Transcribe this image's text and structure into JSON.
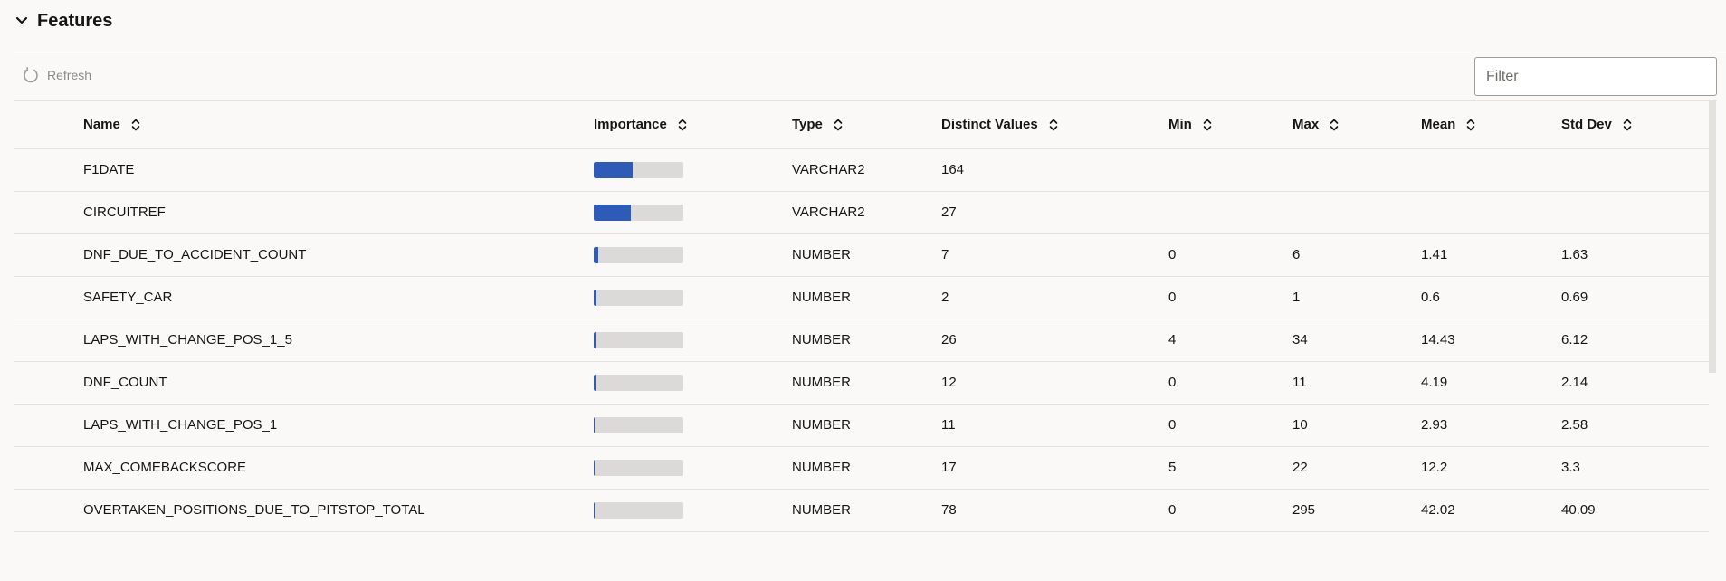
{
  "section": {
    "title": "Features",
    "expanded": true
  },
  "toolbar": {
    "refresh_label": "Refresh",
    "filter_placeholder": "Filter",
    "filter_value": ""
  },
  "colors": {
    "importance_fill": "#2e5bb8",
    "importance_track": "#dcdad8"
  },
  "table": {
    "columns": [
      "Name",
      "Importance",
      "Type",
      "Distinct Values",
      "Min",
      "Max",
      "Mean",
      "Std Dev"
    ],
    "rows": [
      {
        "name": "F1DATE",
        "importance": 0.43,
        "type": "VARCHAR2",
        "distinct": "164",
        "min": "",
        "max": "",
        "mean": "",
        "std": ""
      },
      {
        "name": "CIRCUITREF",
        "importance": 0.41,
        "type": "VARCHAR2",
        "distinct": "27",
        "min": "",
        "max": "",
        "mean": "",
        "std": ""
      },
      {
        "name": "DNF_DUE_TO_ACCIDENT_COUNT",
        "importance": 0.05,
        "type": "NUMBER",
        "distinct": "7",
        "min": "0",
        "max": "6",
        "mean": "1.41",
        "std": "1.63"
      },
      {
        "name": "SAFETY_CAR",
        "importance": 0.03,
        "type": "NUMBER",
        "distinct": "2",
        "min": "0",
        "max": "1",
        "mean": "0.6",
        "std": "0.69"
      },
      {
        "name": "LAPS_WITH_CHANGE_POS_1_5",
        "importance": 0.025,
        "type": "NUMBER",
        "distinct": "26",
        "min": "4",
        "max": "34",
        "mean": "14.43",
        "std": "6.12"
      },
      {
        "name": "DNF_COUNT",
        "importance": 0.02,
        "type": "NUMBER",
        "distinct": "12",
        "min": "0",
        "max": "11",
        "mean": "4.19",
        "std": "2.14"
      },
      {
        "name": "LAPS_WITH_CHANGE_POS_1",
        "importance": 0.015,
        "type": "NUMBER",
        "distinct": "11",
        "min": "0",
        "max": "10",
        "mean": "2.93",
        "std": "2.58"
      },
      {
        "name": "MAX_COMEBACKSCORE",
        "importance": 0.012,
        "type": "NUMBER",
        "distinct": "17",
        "min": "5",
        "max": "22",
        "mean": "12.2",
        "std": "3.3"
      },
      {
        "name": "OVERTAKEN_POSITIONS_DUE_TO_PITSTOP_TOTAL",
        "importance": 0.01,
        "type": "NUMBER",
        "distinct": "78",
        "min": "0",
        "max": "295",
        "mean": "42.02",
        "std": "40.09"
      }
    ]
  }
}
